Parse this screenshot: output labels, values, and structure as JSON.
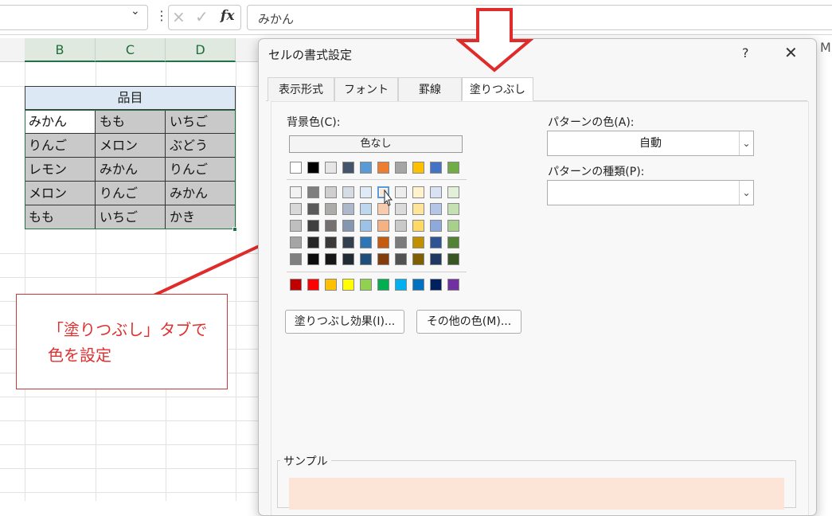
{
  "formula_bar": {
    "name_box_value": "",
    "cancel_icon": "×",
    "enter_icon": "✓",
    "fx_label": "fx",
    "formula_value": "みかん"
  },
  "columns": {
    "B": "B",
    "C": "C",
    "D": "D",
    "M": "M"
  },
  "table": {
    "header": "品目",
    "rows": [
      [
        "みかん",
        "もも",
        "いちご"
      ],
      [
        "りんご",
        "メロン",
        "ぶどう"
      ],
      [
        "レモン",
        "みかん",
        "りんご"
      ],
      [
        "メロン",
        "りんご",
        "みかん"
      ],
      [
        "もも",
        "いちご",
        "かき"
      ]
    ]
  },
  "callout": {
    "line1": "「塗りつぶし」タブで",
    "line2": "色を設定"
  },
  "dialog": {
    "title": "セルの書式設定",
    "help": "?",
    "close": "✕",
    "tabs": [
      "表示形式",
      "フォント",
      "罫線",
      "塗りつぶし"
    ],
    "active_tab": "塗りつぶし",
    "bg_color_label": "背景色(C):",
    "no_color_button": "色なし",
    "theme_row": [
      "#ffffff",
      "#000000",
      "#e7e6e6",
      "#44546a",
      "#5b9bd5",
      "#ed7d31",
      "#a5a5a5",
      "#ffc000",
      "#4472c4",
      "#70ad47"
    ],
    "shade_rows": [
      [
        "#f2f2f2",
        "#7f7f7f",
        "#d0cece",
        "#d6dce4",
        "#deebf6",
        "#fbe5d5",
        "#ededed",
        "#fff2cc",
        "#d9e2f3",
        "#e2efd9"
      ],
      [
        "#d8d8d8",
        "#595959",
        "#aeabab",
        "#adb9ca",
        "#bdd7ee",
        "#f7cbac",
        "#dbdbdb",
        "#fee599",
        "#b4c6e7",
        "#c5e0b3"
      ],
      [
        "#bfbfbf",
        "#3f3f3f",
        "#757070",
        "#8496b0",
        "#9cc3e5",
        "#f4b183",
        "#c9c9c9",
        "#ffd965",
        "#8eaadb",
        "#a8d08d"
      ],
      [
        "#a5a5a5",
        "#262626",
        "#3a3838",
        "#323f4f",
        "#2e75b5",
        "#c55a11",
        "#7b7b7b",
        "#bf9000",
        "#2f5496",
        "#538135"
      ],
      [
        "#7f7f7f",
        "#0c0c0c",
        "#171616",
        "#222a35",
        "#1e4e79",
        "#833c0b",
        "#525252",
        "#7f6000",
        "#1f3864",
        "#375623"
      ]
    ],
    "standard_row": [
      "#c00000",
      "#ff0000",
      "#ffc000",
      "#ffff00",
      "#92d050",
      "#00b050",
      "#00b0f0",
      "#0070c0",
      "#002060",
      "#7030a0"
    ],
    "selected_color": "#fbe5d5",
    "fill_effects_button": "塗りつぶし効果(I)...",
    "more_colors_button": "その他の色(M)...",
    "pattern_color_label": "パターンの色(A):",
    "pattern_color_value": "自動",
    "pattern_style_label": "パターンの種類(P):",
    "pattern_style_value": "",
    "sample_label": "サンプル",
    "sample_color": "#fce4d6"
  },
  "colors": {
    "excel_green": "#217346",
    "callout_red": "#e03030"
  }
}
